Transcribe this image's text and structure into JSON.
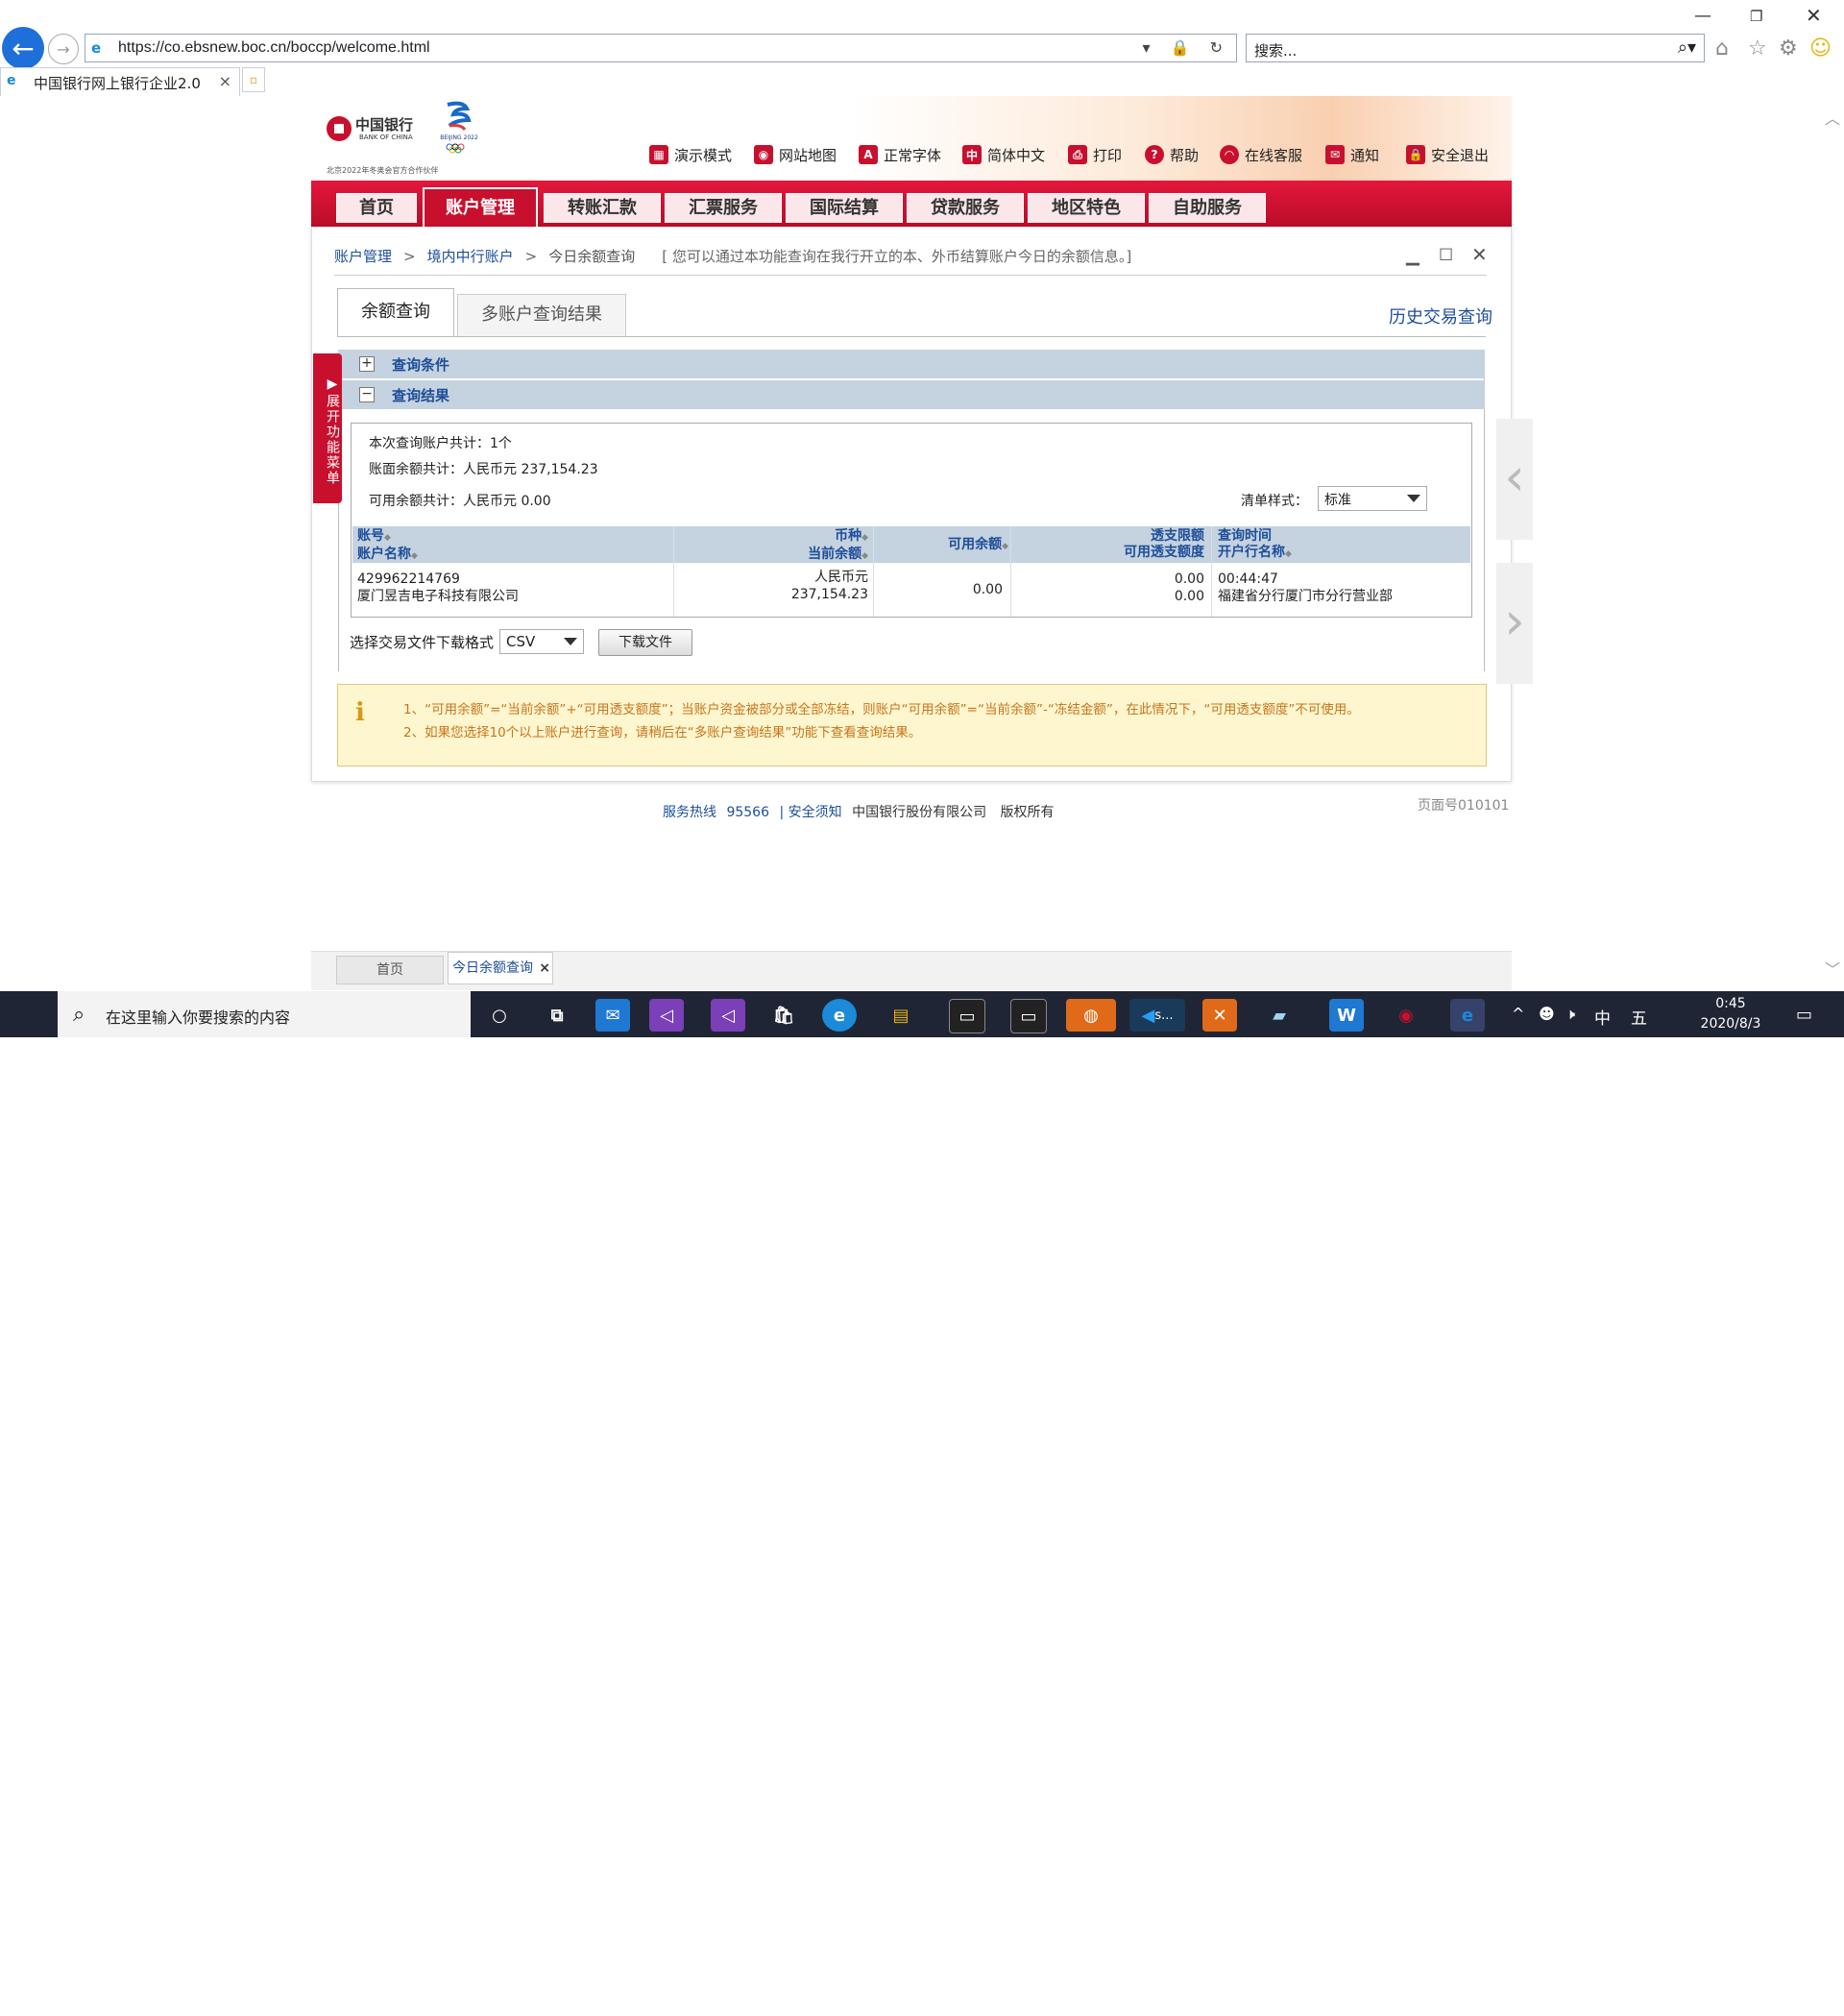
{
  "browser": {
    "url": "https://co.ebsnew.boc.cn/boccp/welcome.html",
    "search_placeholder": "搜索...",
    "tab_title": "中国银行网上银行企业2.0",
    "tab_close": "×"
  },
  "bank": {
    "logo_cn": "中国银行",
    "logo_en": "BANK OF CHINA",
    "partner": "北京2022年冬奥会官方合作伙伴",
    "beijing_logo_text": "BEIJING 2022",
    "topnav": [
      "演示模式",
      "网站地图",
      "正常字体",
      "简体中文",
      "打印",
      "帮助",
      "在线客服",
      "通知",
      "安全退出"
    ],
    "mainnav": [
      "首页",
      "账户管理",
      "转账汇款",
      "汇票服务",
      "国际结算",
      "贷款服务",
      "地区特色",
      "自助服务"
    ],
    "active_nav": "账户管理"
  },
  "breadcrumb": {
    "level1": "账户管理",
    "level2": "境内中行账户",
    "level3": "今日余额查询",
    "sep": ">",
    "tip": "[ 您可以通过本功能查询在我行开立的本、外币结算账户今日的余额信息。]"
  },
  "subtabs": {
    "tab1": "余额查询",
    "tab2": "多账户查询结果",
    "history": "历史交易查询"
  },
  "sections": {
    "conditions": "查询条件",
    "results": "查询结果",
    "expand": "+",
    "collapse": "−"
  },
  "side_menu": "展开功能菜单",
  "summary": {
    "count": "本次查询账户共计：1个",
    "book_balance": "账面余额共计：人民币元 237,154.23",
    "avail_balance": "可用余额共计：人民币元 0.00",
    "list_style_label": "清单样式：",
    "list_style_value": "标准"
  },
  "table": {
    "headers": {
      "acct_no": "账号",
      "acct_name": "账户名称",
      "currency": "币种",
      "current_balance": "当前余额",
      "avail": "可用余额",
      "overdraft_limit": "透支限额",
      "avail_overdraft": "可用透支额度",
      "query_time": "查询时间",
      "branch": "开户行名称"
    },
    "rows": [
      {
        "acct_no": "429962214769",
        "acct_name": "厦门昱吉电子科技有限公司",
        "currency": "人民币元",
        "current_balance": "237,154.23",
        "avail": "0.00",
        "overdraft_limit": "0.00",
        "avail_overdraft": "0.00",
        "query_time": "00:44:47",
        "branch": "福建省分行厦门市分行营业部"
      }
    ]
  },
  "download": {
    "label": "选择交易文件下载格式",
    "format": "CSV",
    "button": "下载文件"
  },
  "notice": {
    "line1": "1、“可用余额”=“当前余额”+“可用透支额度”；当账户资金被部分或全部冻结，则账户“可用余额”=“当前余额”-“冻结金额”，在此情况下，“可用透支额度”不可使用。",
    "line2": "2、如果您选择10个以上账户进行查询，请稍后在“多账户查询结果”功能下查看查询结果。"
  },
  "footer": {
    "hotline_label": "服务热线",
    "hotline": "95566",
    "sep": "|",
    "security": "安全须知",
    "company": "中国银行股份有限公司",
    "rights": "版权所有",
    "page_no": "页面号010101"
  },
  "bottom_tabs": {
    "home": "首页",
    "active": "今日余额查询",
    "close": "×"
  },
  "taskbar": {
    "search_placeholder": "在这里输入你要搜索的内容",
    "time": "0:45",
    "date": "2020/8/3",
    "ime": "中",
    "ime2": "五",
    "vscode_label": "s..."
  }
}
